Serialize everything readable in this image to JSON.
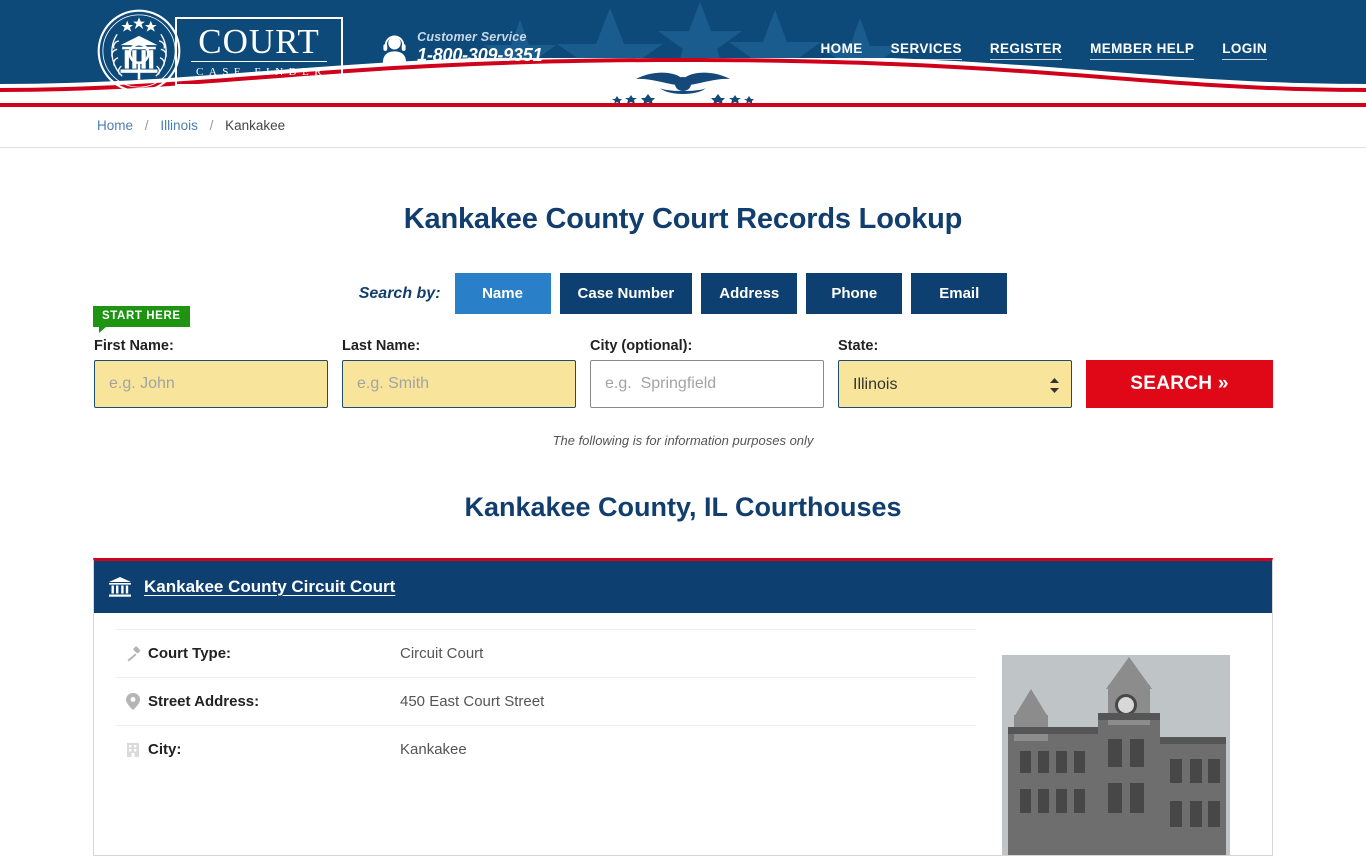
{
  "header": {
    "logo": {
      "word": "COURT",
      "sub": "CASE FINDER",
      "seal_icon": "court-seal-icon"
    },
    "customer_service": {
      "label": "Customer Service",
      "phone": "1-800-309-9351",
      "icon": "headset-support-icon"
    },
    "nav": [
      {
        "label": "HOME"
      },
      {
        "label": "SERVICES"
      },
      {
        "label": "REGISTER"
      },
      {
        "label": "MEMBER HELP"
      },
      {
        "label": "LOGIN"
      }
    ],
    "colors": {
      "navy": "#0d4a7a",
      "red": "#d0021b"
    }
  },
  "breadcrumb": {
    "home": "Home",
    "state": "Illinois",
    "current": "Kankakee",
    "separator": "/"
  },
  "page": {
    "title": "Kankakee County Court Records Lookup",
    "section_title": "Kankakee County, IL Courthouses",
    "disclaimer": "The following is for information purposes only"
  },
  "search": {
    "search_by_label": "Search by:",
    "tabs": [
      {
        "label": "Name",
        "active": true
      },
      {
        "label": "Case Number",
        "active": false
      },
      {
        "label": "Address",
        "active": false
      },
      {
        "label": "Phone",
        "active": false
      },
      {
        "label": "Email",
        "active": false
      }
    ],
    "start_here_badge": "START HERE",
    "fields": {
      "first_name": {
        "label": "First Name:",
        "placeholder": "e.g. John",
        "value": ""
      },
      "last_name": {
        "label": "Last Name:",
        "placeholder": "e.g. Smith",
        "value": ""
      },
      "city": {
        "label": "City (optional):",
        "placeholder": "e.g.  Springfield",
        "value": ""
      },
      "state": {
        "label": "State:",
        "value": "Illinois"
      }
    },
    "submit_label": "SEARCH »",
    "colors": {
      "active_tab": "#2980c9",
      "tab": "#0d4071",
      "button": "#e00717",
      "field_fill": "#f8e59b"
    }
  },
  "courthouse": {
    "name": "Kankakee County Circuit Court",
    "icon": "bank-columns-icon",
    "photo_alt": "courthouse-photo",
    "rows": [
      {
        "icon": "gavel-icon",
        "label": "Court Type:",
        "value": "Circuit Court"
      },
      {
        "icon": "map-pin-icon",
        "label": "Street Address:",
        "value": "450 East Court Street"
      },
      {
        "icon": "building-icon",
        "label": "City:",
        "value": "Kankakee"
      }
    ]
  }
}
